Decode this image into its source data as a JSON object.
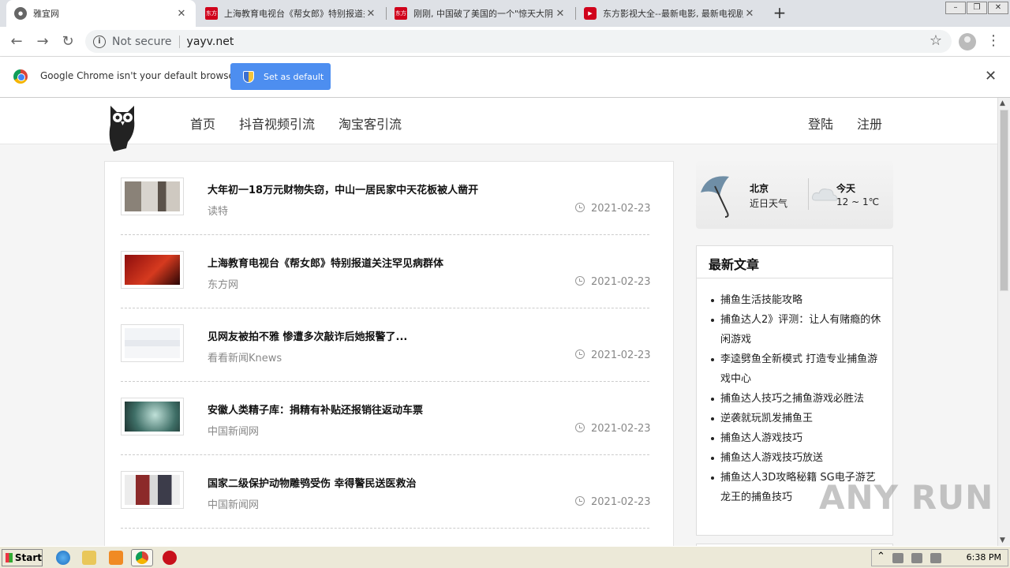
{
  "browser": {
    "tabs": [
      {
        "title": "雅宜网",
        "favicon": "globe-icon",
        "active": true
      },
      {
        "title": "上海教育电视台《帮女郎》特别报道关",
        "favicon": "dongfang-icon",
        "active": false
      },
      {
        "title": "刚刚, 中国破了美国的一个\"惊天大阴",
        "favicon": "dongfang-icon",
        "active": false
      },
      {
        "title": "东方影视大全--最新电影, 最新电视剧",
        "favicon": "play-icon",
        "active": false
      }
    ],
    "new_tab_label": "+",
    "window_controls": [
      "–",
      "❐",
      "✕"
    ],
    "security_label": "Not secure",
    "url": "yayv.net",
    "infobar": {
      "message": "Google Chrome isn't your default browser",
      "button_label": "Set as default",
      "button_color": "#4d8ef0"
    }
  },
  "site": {
    "nav": [
      "首页",
      "抖音视频引流",
      "淘宝客引流"
    ],
    "auth": {
      "login": "登陆",
      "register": "注册"
    },
    "articles": [
      {
        "title": "大年初一18万元财物失窃，中山一居民家中天花板被人凿开",
        "source": "读特",
        "date": "2021-02-23"
      },
      {
        "title": "上海教育电视台《帮女郎》特别报道关注罕见病群体",
        "source": "东方网",
        "date": "2021-02-23"
      },
      {
        "title": "见网友被拍不雅 惨遭多次敲诈后她报警了...",
        "source": "看看新闻Knews",
        "date": "2021-02-23"
      },
      {
        "title": "安徽人类精子库：捐精有补贴还报销往返动车票",
        "source": "中国新闻网",
        "date": "2021-02-23"
      },
      {
        "title": "国家二级保护动物雕鸮受伤 幸得警民送医救治",
        "source": "中国新闻网",
        "date": "2021-02-23"
      }
    ],
    "weather": {
      "city": "北京",
      "city_sub": "近日天气",
      "today": "今天",
      "temp": "12 ~ 1℃"
    },
    "latest": {
      "heading": "最新文章",
      "items": [
        "捕鱼生活技能攻略",
        "捕鱼达人2》评测：让人有赌瘾的休闲游戏",
        "李逵劈鱼全新模式 打造专业捕鱼游戏中心",
        "捕鱼达人技巧之捕鱼游戏必胜法",
        "逆袭就玩凯发捕鱼王",
        "捕鱼达人游戏技巧",
        "捕鱼达人游戏技巧放送",
        "捕鱼达人3D攻略秘籍 SG电子游艺龙王的捕鱼技巧"
      ]
    }
  },
  "watermark": "ANY RUN",
  "taskbar": {
    "start_label": "Start",
    "clock": "6:38 PM"
  }
}
